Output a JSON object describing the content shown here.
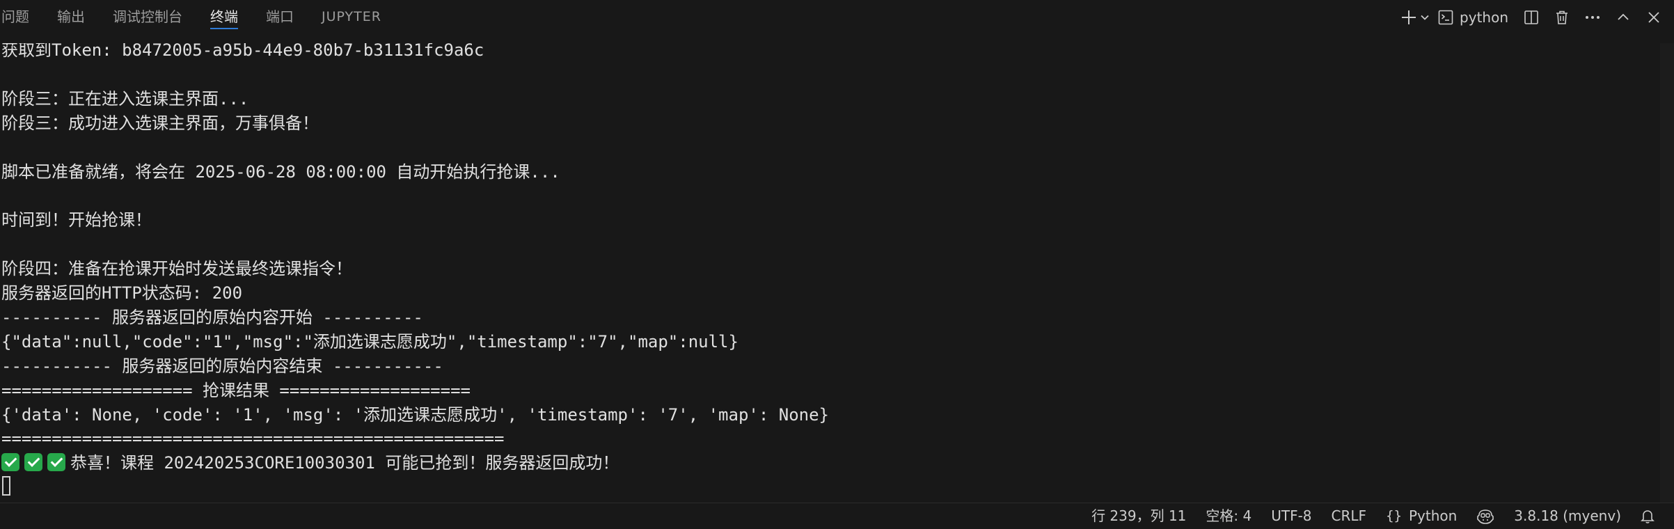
{
  "panel": {
    "tabs": [
      {
        "label": "问题",
        "active": false
      },
      {
        "label": "输出",
        "active": false
      },
      {
        "label": "调试控制台",
        "active": false
      },
      {
        "label": "终端",
        "active": true
      },
      {
        "label": "端口",
        "active": false
      },
      {
        "label": "JUPYTER",
        "active": false
      }
    ],
    "actions": {
      "profile_label": "python",
      "icons": [
        "plus-icon",
        "chevron-down-icon",
        "terminal-icon",
        "split-icon",
        "trash-icon",
        "more-icon",
        "chevron-up-icon",
        "close-icon"
      ]
    }
  },
  "terminal": {
    "lines": [
      "获取到Token: b8472005-a95b-44e9-80b7-b31131fc9a6c",
      "",
      "阶段三：正在进入选课主界面...",
      "阶段三：成功进入选课主界面，万事俱备！",
      "",
      "脚本已准备就绪，将会在 2025-06-28 08:00:00 自动开始执行抢课...",
      "",
      "时间到！开始抢课！",
      "",
      "阶段四：准备在抢课开始时发送最终选课指令！",
      "服务器返回的HTTP状态码: 200",
      "---------- 服务器返回的原始内容开始 ----------",
      "{\"data\":null,\"code\":\"1\",\"msg\":\"添加选课志愿成功\",\"timestamp\":\"7\",\"map\":null}",
      "----------- 服务器返回的原始内容结束 -----------",
      "=================== 抢课结果 ===================",
      "{'data': None, 'code': '1', 'msg': '添加选课志愿成功', 'timestamp': '7', 'map': None}",
      "=================================================="
    ],
    "success_line": {
      "checks": 3,
      "text": "恭喜！课程 202420253CORE10030301 可能已抢到！服务器返回成功！"
    }
  },
  "statusbar": {
    "position": "行 239，列 11",
    "spaces": "空格: 4",
    "encoding": "UTF-8",
    "eol": "CRLF",
    "language_brace": "{}",
    "language": "Python",
    "interpreter": "3.8.18 (myenv)"
  },
  "colors": {
    "background": "#181818",
    "active_tab_underline": "#2f7bd6",
    "check_green": "#27a94b",
    "text": "#cccccc"
  }
}
